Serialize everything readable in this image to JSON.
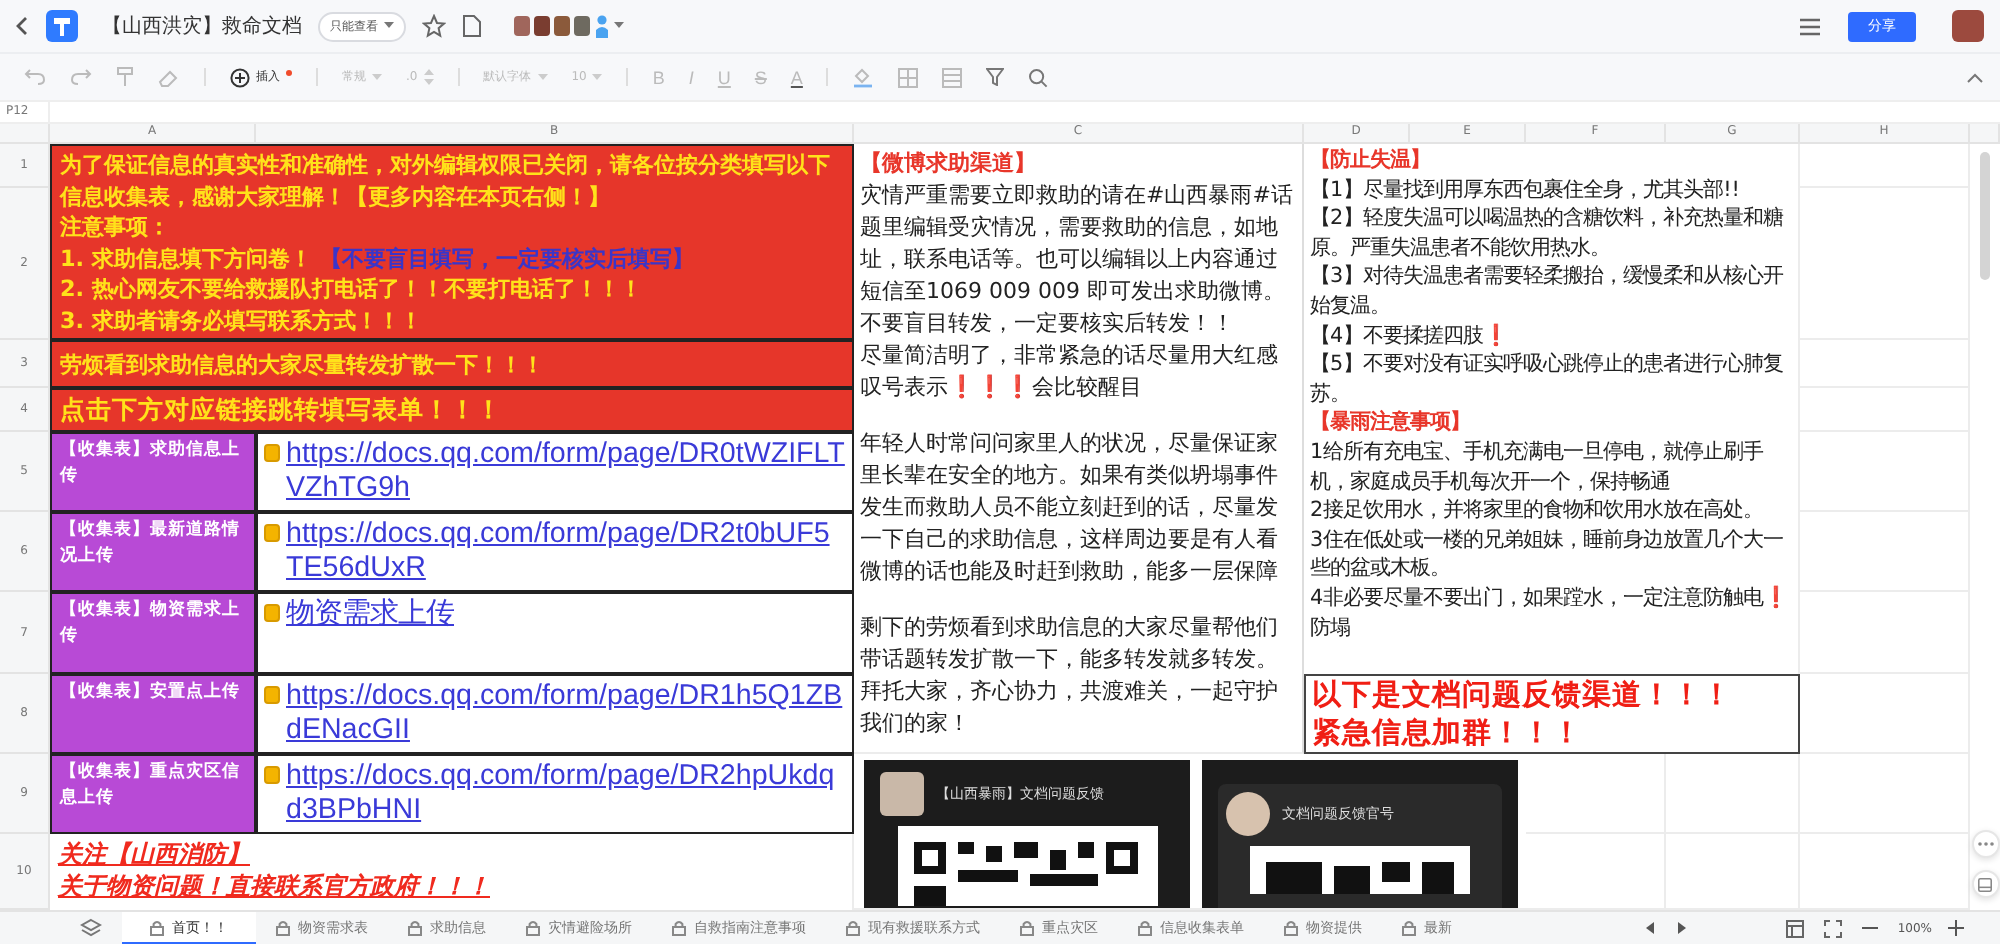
{
  "app_bar": {
    "title": "【山西洪灾】救命文档",
    "permission": "只能查看",
    "share_button": "分享"
  },
  "toolbar": {
    "items": [
      {
        "kind": "insert",
        "label": "插入",
        "disabled": false
      },
      {
        "kind": "dropdown",
        "label": "常规",
        "disabled": true
      },
      {
        "kind": "stepper",
        "label": ".0",
        "disabled": true
      },
      {
        "kind": "dropdown",
        "label": "默认字体",
        "disabled": true
      },
      {
        "kind": "dropdown",
        "label": "10",
        "disabled": true
      }
    ],
    "format_buttons": [
      "B",
      "I",
      "U",
      "S",
      "A"
    ]
  },
  "cell_ref": "P12",
  "sheet": {
    "columns": [
      "A",
      "B",
      "C",
      "D",
      "E",
      "F",
      "G",
      "H"
    ],
    "rows": [
      "1",
      "2",
      "3",
      "4",
      "5",
      "6",
      "7",
      "8",
      "9",
      "10"
    ],
    "notice": [
      {
        "text": "为了保证信息的真实性和准确性，对外编辑权限已关闭，请各位按分类填写以下信息收集表，感谢大家理解！【更多内容在本页右侧！】"
      },
      {
        "text": "注意事项："
      },
      {
        "text": "1. 求助信息填下方问卷！",
        "note": "【不要盲目填写，一定要核实后填写】"
      },
      {
        "text": "2. 热心网友不要给救援队打电话了！！不要打电话了！！！"
      },
      {
        "text": "3. 求助者请务必填写联系方式！！！"
      }
    ],
    "banners": [
      "劳烦看到求助信息的大家尽量转发扩散一下！！！",
      "点击下方对应链接跳转填写表单！！！"
    ],
    "forms": [
      {
        "label": "【收集表】求助信息上传",
        "link": "https://docs.qq.com/form/page/DR0tWZIFLTVZhTG9h"
      },
      {
        "label": "【收集表】最新道路情况上传",
        "link": "https://docs.qq.com/form/page/DR2t0bUF5TE56dUxR"
      },
      {
        "label": "【收集表】物资需求上传",
        "link": "物资需求上传"
      },
      {
        "label": "【收集表】安置点上传",
        "link": "https://docs.qq.com/form/page/DR1h5Q1ZBdENacGII"
      },
      {
        "label": "【收集表】重点灾区信息上传",
        "link": "https://docs.qq.com/form/page/DR2hpUkdqd3BPbHNI"
      }
    ],
    "follow": [
      "关注【山西消防】",
      "关于物资问题！直接联系官方政府！！！"
    ],
    "weibo": {
      "heading": "【微博求助渠道】",
      "blocks": [
        [
          "灾情严重需要立即救助的请在#山西暴雨#话题里编辑受灾情况，需要救助的信息，如地址，联系电话等。也可以编辑以上内容通过短信至1069 009 009 即可发出求助微博。",
          "不要盲目转发，一定要核实后转发！！",
          "尽量简洁明了，非常紧急的话尽量用大红感叹号表示❗❗❗会比较醒目"
        ],
        [
          "年轻人时常问问家里人的状况，尽量保证家里长辈在安全的地方。如果有类似坍塌事件发生而救助人员不能立刻赶到的话，尽量发一下自己的求助信息，这样周边要是有人看微博的话也能及时赶到救助，能多一层保障"
        ],
        [
          "剩下的劳烦看到求助信息的大家尽量帮他们带话题转发扩散一下，能多转发就多转发。拜托大家，齐心协力，共渡难关，一起守护我们的家！"
        ]
      ]
    },
    "tips": [
      {
        "heading": "【防止失温】",
        "items": [
          "【1】尽量找到用厚东西包裹住全身，尤其头部!!",
          "【2】轻度失温可以喝温热的含糖饮料，补充热量和糖原。严重失温患者不能饮用热水。",
          "【3】对待失温患者需要轻柔搬抬，缓慢柔和从核心开始复温。",
          "【4】不要揉搓四肢❗",
          "【5】不要对没有证实呼吸心跳停止的患者进行心肺复苏。"
        ]
      },
      {
        "heading": "【暴雨注意事项】",
        "items": [
          "1给所有充电宝、手机充满电一旦停电，就停止刷手机，家庭成员手机每次开一个，保持畅通",
          "2接足饮用水，并将家里的食物和饮用水放在高处。",
          "3住在低处或一楼的兄弟姐妹，睡前身边放置几个大一些的盆或木板。",
          "4非必要尽量不要出门，如果蹚水，一定注意防触电❗防塌"
        ]
      }
    ],
    "feedback": [
      "以下是文档问题反馈渠道！！！",
      "紧急信息加群！！！"
    ],
    "images": [
      {
        "kind": "group",
        "title": "【山西暴雨】文档问题反馈"
      },
      {
        "kind": "account",
        "title": "文档问题反馈官号"
      }
    ]
  },
  "tabs": [
    {
      "label": "首页！！",
      "selected": true
    },
    {
      "label": "物资需求表",
      "selected": false
    },
    {
      "label": "求助信息",
      "selected": false
    },
    {
      "label": "灾情避险场所",
      "selected": false
    },
    {
      "label": "自救指南注意事项",
      "selected": false
    },
    {
      "label": "现有救援联系方式",
      "selected": false
    },
    {
      "label": "重点灾区",
      "selected": false
    },
    {
      "label": "信息收集表单",
      "selected": false
    },
    {
      "label": "物资提供",
      "selected": false
    },
    {
      "label": "最新",
      "selected": false
    }
  ],
  "zoom": "100%"
}
